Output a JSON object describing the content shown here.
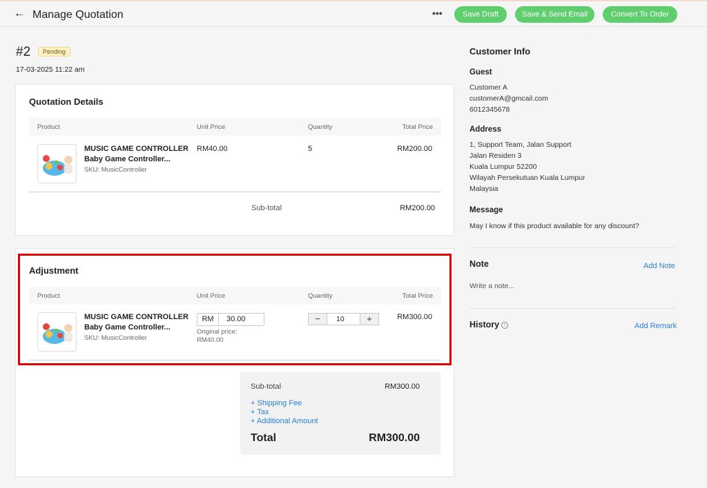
{
  "header": {
    "back_icon": "arrow-left-icon",
    "title": "Manage Quotation",
    "more_icon": "more-dots-icon",
    "more_label": "•••",
    "buttons": {
      "save_draft": "Save Draft",
      "save_send": "Save & Send Email",
      "convert": "Convert To Order"
    },
    "button_color": "#5fce6c"
  },
  "quotation": {
    "number": "#2",
    "status": "Pending",
    "date": "17-03-2025 11:22 am"
  },
  "details": {
    "title": "Quotation Details",
    "columns": [
      "Product",
      "Unit Price",
      "Quantity",
      "Total Price"
    ],
    "item": {
      "name1": "MUSIC GAME CONTROLLER",
      "name2": "Baby Game Controller...",
      "sku": "SKU: MusicController",
      "unit_price": "RM40.00",
      "quantity": "5",
      "total": "RM200.00"
    },
    "subtotal_label": "Sub-total",
    "subtotal": "RM200.00"
  },
  "adjustment": {
    "title": "Adjustment",
    "columns": [
      "Product",
      "Unit Price",
      "Quantity",
      "Total Price"
    ],
    "item": {
      "name1": "MUSIC GAME CONTROLLER",
      "name2": "Baby Game Controller...",
      "sku": "SKU: MusicController",
      "currency": "RM",
      "price_value": "30.00",
      "orig_label": "Original price:",
      "orig_value": "RM40.00",
      "minus": "−",
      "quantity": "10",
      "plus": "+",
      "total": "RM300.00"
    },
    "highlight_color": "#e00000"
  },
  "summary": {
    "subtotal_label": "Sub-total",
    "subtotal": "RM300.00",
    "links": [
      "+ Shipping Fee",
      "+ Tax",
      "+ Additional Amount"
    ],
    "total_label": "Total",
    "total": "RM300.00"
  },
  "sidebar": {
    "title": "Customer Info",
    "guest_label": "Guest",
    "guest": [
      "Customer A",
      "customerA@gmcail.com",
      "6012345678"
    ],
    "address_label": "Address",
    "address": [
      "1, Support Team, Jalan Support",
      "Jalan Residen 3",
      "Kuala Lumpur 52200",
      "Wilayah Persekutuan Kuala Lumpur",
      "Malaysia"
    ],
    "message_label": "Message",
    "message": "May I know if this product available for any discount?",
    "note_label": "Note",
    "add_note": "Add Note",
    "note_placeholder": "Write a note...",
    "history_label": "History",
    "info_icon": "info-icon",
    "info_glyph": "i",
    "add_remark": "Add Remark",
    "link_color": "#2b7fd6"
  }
}
